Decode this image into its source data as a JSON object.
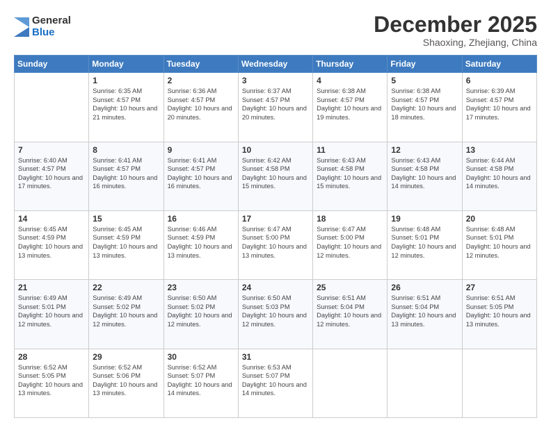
{
  "logo": {
    "general": "General",
    "blue": "Blue"
  },
  "header": {
    "month": "December 2025",
    "location": "Shaoxing, Zhejiang, China"
  },
  "days_of_week": [
    "Sunday",
    "Monday",
    "Tuesday",
    "Wednesday",
    "Thursday",
    "Friday",
    "Saturday"
  ],
  "weeks": [
    [
      {
        "day": "",
        "content": ""
      },
      {
        "day": "1",
        "content": "Sunrise: 6:35 AM\nSunset: 4:57 PM\nDaylight: 10 hours and 21 minutes."
      },
      {
        "day": "2",
        "content": "Sunrise: 6:36 AM\nSunset: 4:57 PM\nDaylight: 10 hours and 20 minutes."
      },
      {
        "day": "3",
        "content": "Sunrise: 6:37 AM\nSunset: 4:57 PM\nDaylight: 10 hours and 20 minutes."
      },
      {
        "day": "4",
        "content": "Sunrise: 6:38 AM\nSunset: 4:57 PM\nDaylight: 10 hours and 19 minutes."
      },
      {
        "day": "5",
        "content": "Sunrise: 6:38 AM\nSunset: 4:57 PM\nDaylight: 10 hours and 18 minutes."
      },
      {
        "day": "6",
        "content": "Sunrise: 6:39 AM\nSunset: 4:57 PM\nDaylight: 10 hours and 17 minutes."
      }
    ],
    [
      {
        "day": "7",
        "content": "Sunrise: 6:40 AM\nSunset: 4:57 PM\nDaylight: 10 hours and 17 minutes."
      },
      {
        "day": "8",
        "content": "Sunrise: 6:41 AM\nSunset: 4:57 PM\nDaylight: 10 hours and 16 minutes."
      },
      {
        "day": "9",
        "content": "Sunrise: 6:41 AM\nSunset: 4:57 PM\nDaylight: 10 hours and 16 minutes."
      },
      {
        "day": "10",
        "content": "Sunrise: 6:42 AM\nSunset: 4:58 PM\nDaylight: 10 hours and 15 minutes."
      },
      {
        "day": "11",
        "content": "Sunrise: 6:43 AM\nSunset: 4:58 PM\nDaylight: 10 hours and 15 minutes."
      },
      {
        "day": "12",
        "content": "Sunrise: 6:43 AM\nSunset: 4:58 PM\nDaylight: 10 hours and 14 minutes."
      },
      {
        "day": "13",
        "content": "Sunrise: 6:44 AM\nSunset: 4:58 PM\nDaylight: 10 hours and 14 minutes."
      }
    ],
    [
      {
        "day": "14",
        "content": "Sunrise: 6:45 AM\nSunset: 4:59 PM\nDaylight: 10 hours and 13 minutes."
      },
      {
        "day": "15",
        "content": "Sunrise: 6:45 AM\nSunset: 4:59 PM\nDaylight: 10 hours and 13 minutes."
      },
      {
        "day": "16",
        "content": "Sunrise: 6:46 AM\nSunset: 4:59 PM\nDaylight: 10 hours and 13 minutes."
      },
      {
        "day": "17",
        "content": "Sunrise: 6:47 AM\nSunset: 5:00 PM\nDaylight: 10 hours and 13 minutes."
      },
      {
        "day": "18",
        "content": "Sunrise: 6:47 AM\nSunset: 5:00 PM\nDaylight: 10 hours and 12 minutes."
      },
      {
        "day": "19",
        "content": "Sunrise: 6:48 AM\nSunset: 5:01 PM\nDaylight: 10 hours and 12 minutes."
      },
      {
        "day": "20",
        "content": "Sunrise: 6:48 AM\nSunset: 5:01 PM\nDaylight: 10 hours and 12 minutes."
      }
    ],
    [
      {
        "day": "21",
        "content": "Sunrise: 6:49 AM\nSunset: 5:01 PM\nDaylight: 10 hours and 12 minutes."
      },
      {
        "day": "22",
        "content": "Sunrise: 6:49 AM\nSunset: 5:02 PM\nDaylight: 10 hours and 12 minutes."
      },
      {
        "day": "23",
        "content": "Sunrise: 6:50 AM\nSunset: 5:02 PM\nDaylight: 10 hours and 12 minutes."
      },
      {
        "day": "24",
        "content": "Sunrise: 6:50 AM\nSunset: 5:03 PM\nDaylight: 10 hours and 12 minutes."
      },
      {
        "day": "25",
        "content": "Sunrise: 6:51 AM\nSunset: 5:04 PM\nDaylight: 10 hours and 12 minutes."
      },
      {
        "day": "26",
        "content": "Sunrise: 6:51 AM\nSunset: 5:04 PM\nDaylight: 10 hours and 13 minutes."
      },
      {
        "day": "27",
        "content": "Sunrise: 6:51 AM\nSunset: 5:05 PM\nDaylight: 10 hours and 13 minutes."
      }
    ],
    [
      {
        "day": "28",
        "content": "Sunrise: 6:52 AM\nSunset: 5:05 PM\nDaylight: 10 hours and 13 minutes."
      },
      {
        "day": "29",
        "content": "Sunrise: 6:52 AM\nSunset: 5:06 PM\nDaylight: 10 hours and 13 minutes."
      },
      {
        "day": "30",
        "content": "Sunrise: 6:52 AM\nSunset: 5:07 PM\nDaylight: 10 hours and 14 minutes."
      },
      {
        "day": "31",
        "content": "Sunrise: 6:53 AM\nSunset: 5:07 PM\nDaylight: 10 hours and 14 minutes."
      },
      {
        "day": "",
        "content": ""
      },
      {
        "day": "",
        "content": ""
      },
      {
        "day": "",
        "content": ""
      }
    ]
  ]
}
